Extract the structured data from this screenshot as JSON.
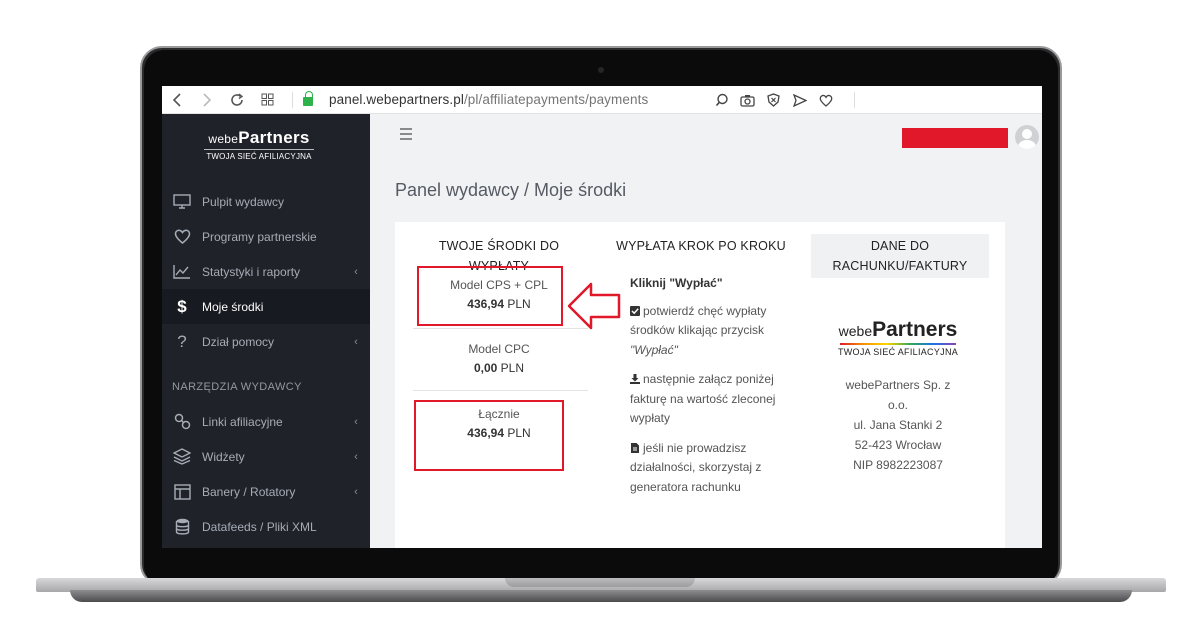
{
  "browser": {
    "url_host": "panel.webepartners.pl",
    "url_path": "/pl/affiliatepayments/payments"
  },
  "sidebar": {
    "logo_small": "webe",
    "logo_main": "Partners",
    "logo_tagline": "TWOJA SIEĆ AFILIACYJNA",
    "items": [
      {
        "label": "Pulpit wydawcy",
        "icon": "monitor-icon"
      },
      {
        "label": "Programy partnerskie",
        "icon": "heart-icon"
      },
      {
        "label": "Statystyki i raporty",
        "icon": "chart-icon"
      },
      {
        "label": "Moje środki",
        "icon": "dollar-icon"
      },
      {
        "label": "Dział pomocy",
        "icon": "question-icon"
      }
    ],
    "tools_title": "NARZĘDZIA WYDAWCY",
    "tools": [
      {
        "label": "Linki afiliacyjne",
        "icon": "link-icon"
      },
      {
        "label": "Widżety",
        "icon": "layers-icon"
      },
      {
        "label": "Banery / Rotatory",
        "icon": "layout-icon"
      },
      {
        "label": "Datafeeds / Pliki XML",
        "icon": "database-icon"
      }
    ]
  },
  "main": {
    "page_title": "Panel wydawcy / Moje środki",
    "col1_header": "TWOJE ŚRODKI DO WYPŁATY",
    "col2_header": "WYPŁATA KROK PO KROKU",
    "col3_header": "DANE DO RACHUNKU/FAKTURY",
    "models": [
      {
        "name": "Model CPS + CPL",
        "amount": "436,94",
        "currency": "PLN"
      },
      {
        "name": "Model CPC",
        "amount": "0,00",
        "currency": "PLN"
      },
      {
        "name": "Łącznie",
        "amount": "436,94",
        "currency": "PLN"
      }
    ],
    "steps": {
      "title": "Kliknij \"Wypłać\"",
      "step1_a": "potwierdź chęć wypłaty środków klikając przycisk ",
      "step1_b": "\"Wypłać\"",
      "step2": "następnie załącz poniżej fakturę na wartość zleconej wypłaty",
      "step3": "jeśli nie prowadzisz działalności, skorzystaj z generatora rachunku"
    },
    "company": {
      "logo_small": "webe",
      "logo_main": "Partners",
      "logo_tagline": "TWOJA SIEĆ AFILIACYJNA",
      "name": "webePartners Sp. z o.o.",
      "street": "ul. Jana Stanki 2",
      "city": "52-423 Wrocław",
      "nip": "NIP 8982223087"
    }
  },
  "colors": {
    "sidebar_bg": "#1f2229",
    "highlight_red": "#e0182a",
    "main_bg": "#f1f2f4"
  }
}
